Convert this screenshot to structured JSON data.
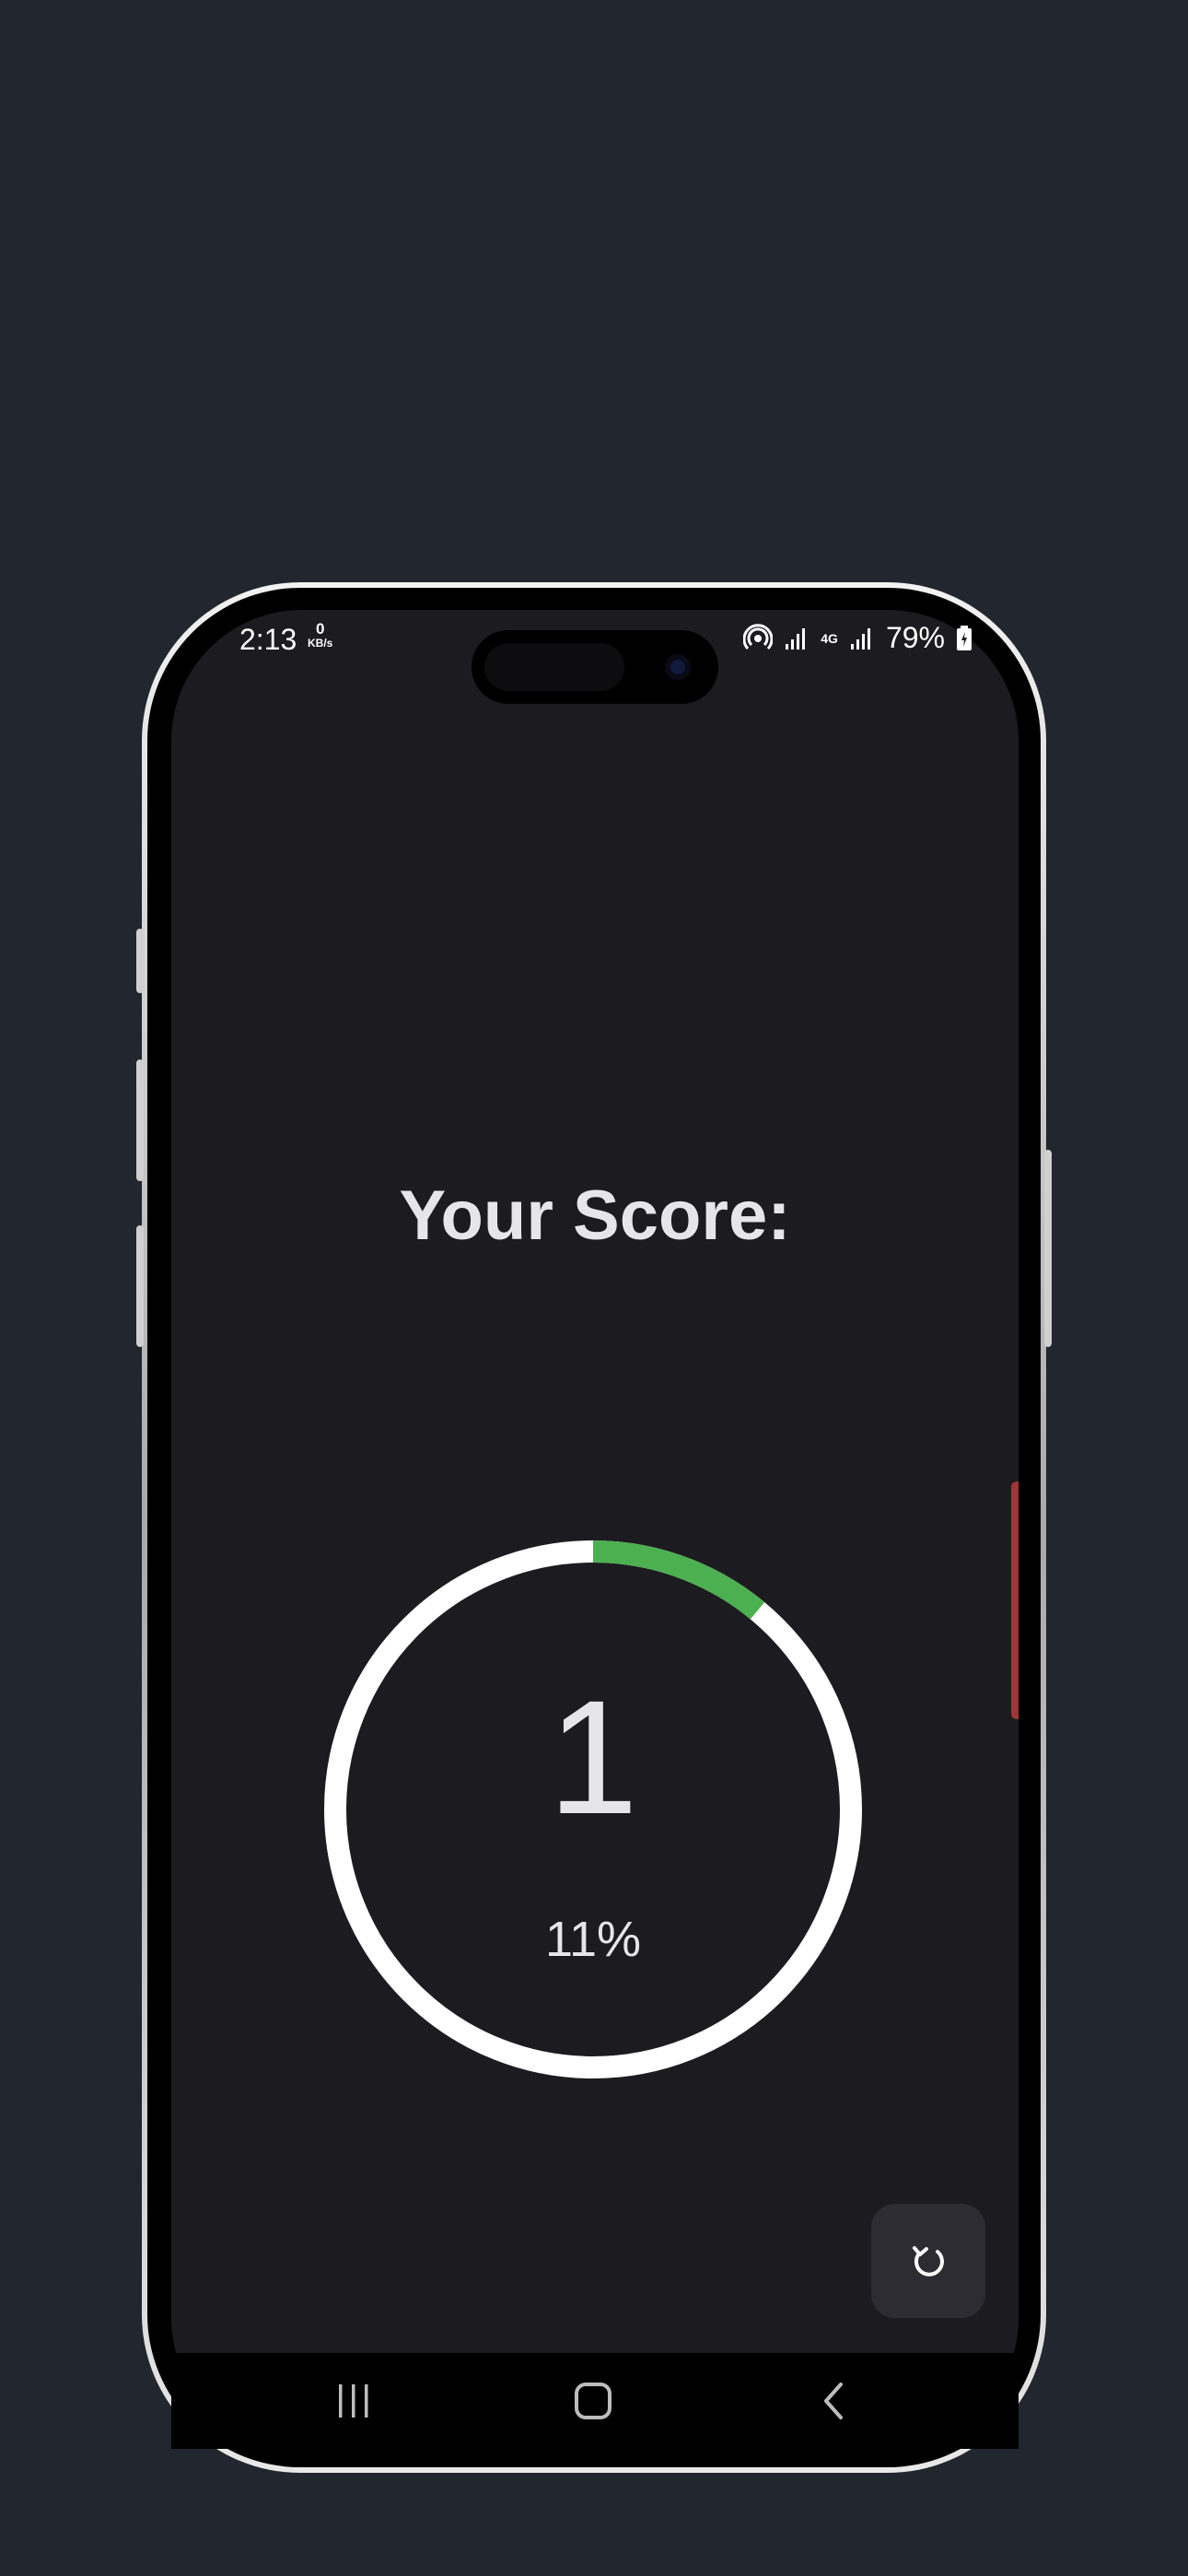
{
  "status_bar": {
    "time": "2:13",
    "net_speed_value": "0",
    "net_speed_unit": "KB/s",
    "network_type": "4G",
    "battery": "79%"
  },
  "result": {
    "title": "Your Score:",
    "score": "1",
    "percent_text": "11%",
    "progress_fraction": 0.11,
    "progress_color": "#4caf50",
    "track_color": "#ffffff"
  },
  "actions": {
    "restart_icon": "refresh-icon"
  },
  "navigation": {
    "recent_icon": "recent-apps-icon",
    "home_icon": "home-icon",
    "back_icon": "back-icon"
  }
}
